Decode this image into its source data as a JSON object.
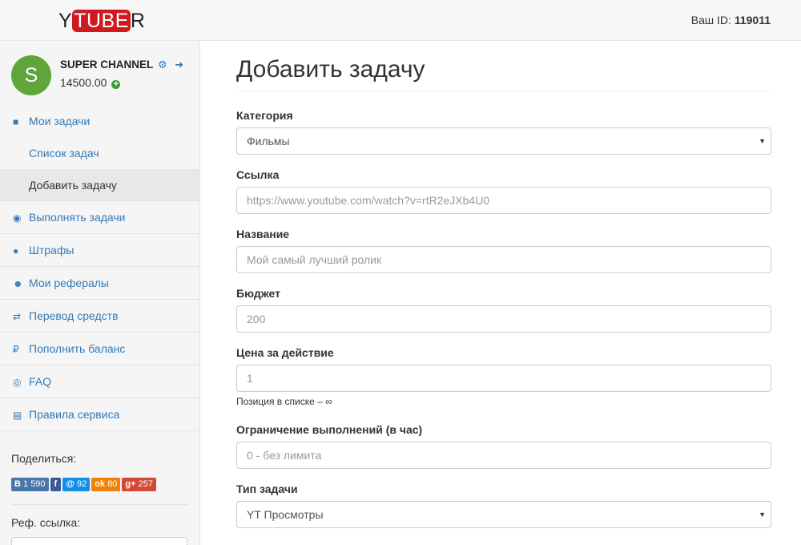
{
  "header": {
    "logo_pre": "Y",
    "logo_tube": "TUBE",
    "logo_post": "R",
    "id_label": "Ваш ID:",
    "id_value": "119011"
  },
  "profile": {
    "avatar_letter": "S",
    "name": "SUPER CHANNEL",
    "balance": "14500.00"
  },
  "menu": {
    "my_tasks": "Мои задачи",
    "task_list": "Список задач",
    "add_task": "Добавить задачу",
    "do_tasks": "Выполнять задачи",
    "penalties": "Штрафы",
    "referrals": "Мои рефералы",
    "transfer": "Перевод средств",
    "topup": "Пополнить баланс",
    "faq": "FAQ",
    "rules": "Правила сервиса"
  },
  "share": {
    "title": "Поделиться:",
    "vk": "1 590",
    "mail": "92",
    "ok": "80",
    "gplus": "257",
    "ref_title": "Реф. ссылка:"
  },
  "colors": {
    "vk": "#4a76a8",
    "fb": "#3b5998",
    "mail": "#168de2",
    "ok": "#ee8208",
    "gplus": "#d34836"
  },
  "form": {
    "title": "Добавить задачу",
    "category_label": "Категория",
    "category_value": "Фильмы",
    "link_label": "Ссылка",
    "link_placeholder": "https://www.youtube.com/watch?v=rtR2eJXb4U0",
    "name_label": "Название",
    "name_placeholder": "Мой самый лучший ролик",
    "budget_label": "Бюджет",
    "budget_placeholder": "200",
    "price_label": "Цена за действие",
    "price_placeholder": "1",
    "price_help": "Позиция в списке – ∞",
    "limit_label": "Ограничение выполнений (в час)",
    "limit_placeholder": "0 - без лимита",
    "type_label": "Тип задачи",
    "type_value": "YT Просмотры"
  }
}
